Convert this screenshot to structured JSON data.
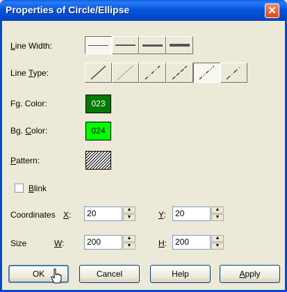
{
  "window": {
    "title": "Properties of Circle/Ellipse"
  },
  "labels": {
    "line_width_pre": "",
    "line_width_mn": "L",
    "line_width_post": "ine Width:",
    "line_type_pre": "Line ",
    "line_type_mn": "T",
    "line_type_post": "ype:",
    "fg_pre": "F",
    "fg_mn": "g",
    "fg_post": ". Color:",
    "bg_pre": "B",
    "bg_mn": "g",
    "bg_post": ". Color:",
    "bg_color_pre": "B",
    "bg_color_mn": "g",
    "bg_color_post": ". ",
    "pattern_mn": "P",
    "pattern_post": "attern:",
    "blink_mn": "B",
    "blink_post": "link",
    "coordinates": "Coordinates",
    "x_mn": "X",
    "x_post": ":",
    "y_mn": "Y",
    "y_post": ":",
    "size": "Size",
    "w_mn": "W",
    "w_post": ":",
    "h_mn": "H",
    "h_post": ":"
  },
  "fg_color": {
    "label": "023",
    "color": "#007a00"
  },
  "bg_color": {
    "label": "024",
    "color": "#00ff00"
  },
  "line_width_options": [
    "thin",
    "medium",
    "thick",
    "thickest"
  ],
  "line_type_options": [
    "solid",
    "dotted",
    "dash-dot",
    "dashed",
    "dash-dot-dot",
    "dash-dash-dot"
  ],
  "line_type_selected": "dash-dot-dot",
  "blink": {
    "checked": false
  },
  "coordinates": {
    "x": "20",
    "y": "20"
  },
  "size": {
    "w": "200",
    "h": "200"
  },
  "buttons": {
    "ok": "OK",
    "cancel": "Cancel",
    "help": "Help",
    "apply_mn": "A",
    "apply_post": "pply"
  }
}
